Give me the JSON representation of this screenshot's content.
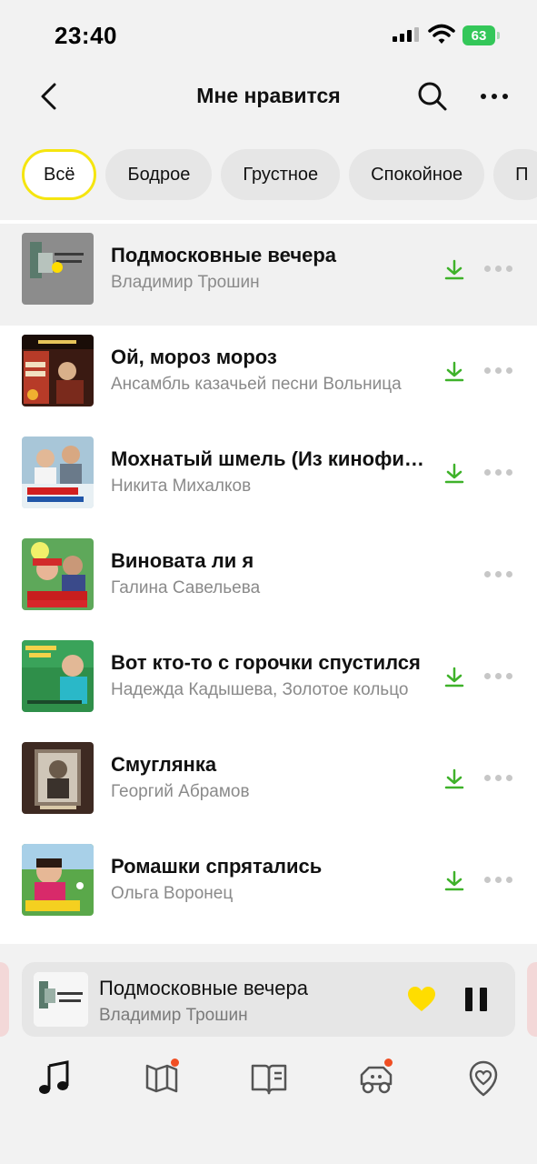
{
  "status": {
    "time": "23:40",
    "battery": "63"
  },
  "header": {
    "title": "Мне нравится"
  },
  "filters": [
    {
      "label": "Всё",
      "active": true
    },
    {
      "label": "Бодрое",
      "active": false
    },
    {
      "label": "Грустное",
      "active": false
    },
    {
      "label": "Спокойное",
      "active": false
    },
    {
      "label": "П",
      "active": false
    }
  ],
  "tracks": [
    {
      "title": "Подмосковные вечера",
      "artist": "Владимир Трошин",
      "downloaded": true,
      "playing": true
    },
    {
      "title": "Ой, мороз мороз",
      "artist": "Ансамбль казачьей песни Вольница",
      "downloaded": true
    },
    {
      "title": "Мохнатый шмель (Из кинофильма «Жестокий романс»)",
      "artist": "Никита Михалков",
      "downloaded": true
    },
    {
      "title": "Виновата ли я",
      "artist": "Галина Савельева",
      "downloaded": false
    },
    {
      "title": "Вот кто-то с горочки спустился",
      "artist": "Надежда Кадышева, Золотое кольцо",
      "downloaded": true
    },
    {
      "title": "Смуглянка",
      "artist": "Георгий Абрамов",
      "downloaded": true
    },
    {
      "title": "Ромашки спрятались",
      "artist": "Ольга Воронец",
      "downloaded": true
    }
  ],
  "player": {
    "title": "Подмосковные вечера",
    "artist": "Владимир Трошин",
    "liked": true,
    "state": "playing"
  },
  "tabs": [
    {
      "icon": "music-note-icon",
      "active": true,
      "badge": false
    },
    {
      "icon": "map-flag-icon",
      "active": false,
      "badge": true
    },
    {
      "icon": "book-icon",
      "active": false,
      "badge": false
    },
    {
      "icon": "kids-car-icon",
      "active": false,
      "badge": true
    },
    {
      "icon": "heart-shield-icon",
      "active": false,
      "badge": false
    }
  ],
  "colors": {
    "accent": "#f5e50f",
    "download": "#3fb22a",
    "heart": "#ffdd00",
    "badge": "#f04e23"
  }
}
